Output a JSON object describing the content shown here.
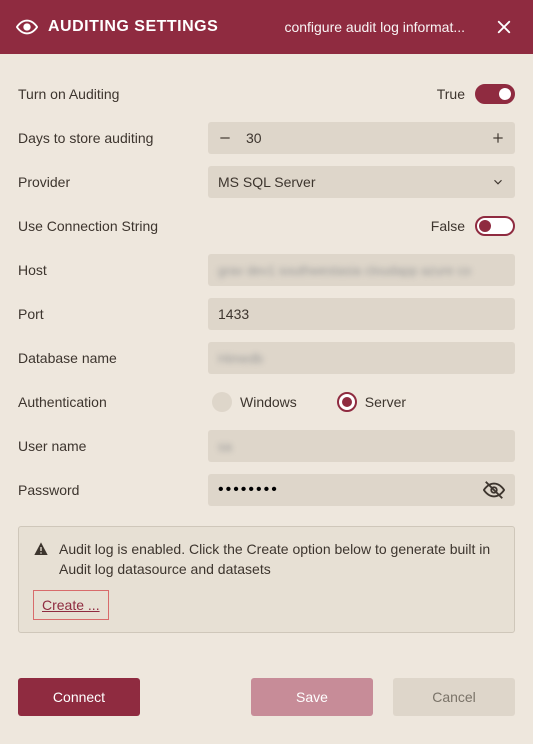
{
  "header": {
    "title": "AUDITING SETTINGS",
    "subtitle": "configure audit log informat..."
  },
  "fields": {
    "turn_on_label": "Turn on Auditing",
    "turn_on_value": "True",
    "days_label": "Days to store auditing",
    "days_value": "30",
    "provider_label": "Provider",
    "provider_value": "MS SQL Server",
    "use_conn_label": "Use Connection String",
    "use_conn_value": "False",
    "host_label": "Host",
    "host_value": "",
    "port_label": "Port",
    "port_value": "1433",
    "db_label": "Database name",
    "db_value": "",
    "auth_label": "Authentication",
    "auth_opt1": "Windows",
    "auth_opt2": "Server",
    "auth_selected": "Server",
    "user_label": "User name",
    "user_value": "",
    "pass_label": "Password",
    "pass_value": "••••••••"
  },
  "info": {
    "message": "Audit log is enabled. Click the Create option below to generate built in Audit log datasource and datasets",
    "create_label": "Create ..."
  },
  "buttons": {
    "connect": "Connect",
    "save": "Save",
    "cancel": "Cancel"
  },
  "colors": {
    "brand": "#8f2b40",
    "panel": "#eee7dd",
    "input": "#ded6ca"
  }
}
